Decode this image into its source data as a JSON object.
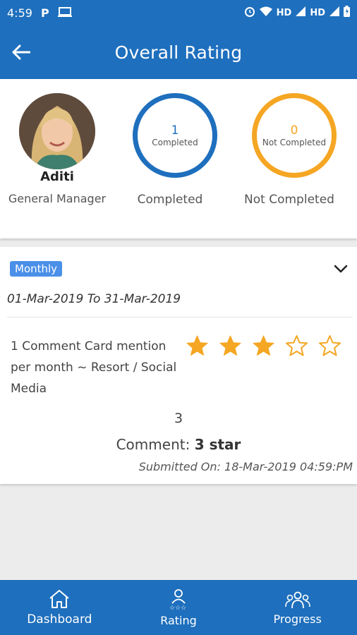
{
  "status_bar": {
    "time": "4:59",
    "p_glyph": "P",
    "network_1": "HD",
    "network_2": "HD"
  },
  "header": {
    "title": "Overall Rating",
    "back_icon": "arrow-left-icon"
  },
  "profile": {
    "name": "Aditi",
    "role": "General Manager",
    "completed": {
      "count": "1",
      "ring_label": "Completed",
      "caption": "Completed",
      "color": "#1e6fbd"
    },
    "not_completed": {
      "count": "0",
      "ring_label": "Not Completed",
      "caption": "Not Completed",
      "color": "#f5a623"
    }
  },
  "rating": {
    "period_badge": "Monthly",
    "date_range": "01-Mar-2019 To 31-Mar-2019",
    "criteria": "1 Comment Card mention per month ~ Resort / Social Media",
    "stars_filled": 3,
    "stars_total": 5,
    "value": "3",
    "comment_label": "Comment:",
    "comment_value": "3 star",
    "submitted": "Submitted On: 18-Mar-2019 04:59:PM"
  },
  "nav": {
    "items": [
      {
        "label": "Dashboard",
        "icon": "home-icon"
      },
      {
        "label": "Rating",
        "icon": "user-stars-icon"
      },
      {
        "label": "Progress",
        "icon": "group-icon"
      }
    ]
  },
  "colors": {
    "primary": "#1e6fbd",
    "accent": "#f5a623",
    "badge": "#4a8fe8"
  }
}
